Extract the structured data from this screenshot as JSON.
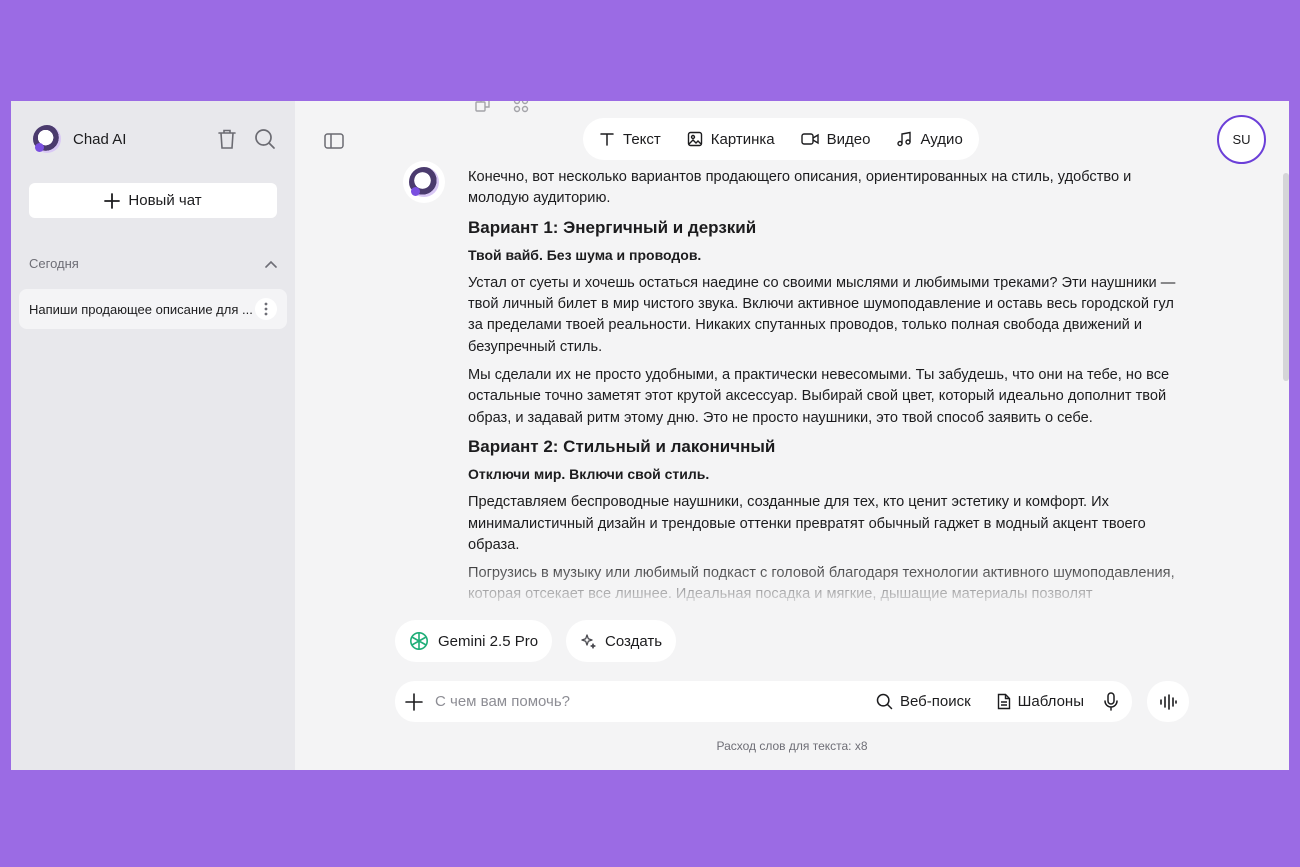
{
  "sidebar": {
    "brand": "Chad AI",
    "new_chat_label": "Новый чат",
    "section_title": "Сегодня",
    "history": [
      {
        "title": "Напиши продающее описание для ..."
      }
    ]
  },
  "modes": [
    {
      "label": "Текст",
      "icon": "text-icon"
    },
    {
      "label": "Картинка",
      "icon": "image-icon"
    },
    {
      "label": "Видео",
      "icon": "video-icon"
    },
    {
      "label": "Аудио",
      "icon": "music-icon"
    }
  ],
  "user": {
    "initials": "SU"
  },
  "message": {
    "intro": "Конечно, вот несколько вариантов продающего описания, ориентированных на стиль, удобство и молодую аудиторию.",
    "variant1": {
      "heading": "Вариант 1: Энергичный и дерзкий",
      "tagline": "Твой вайб. Без шума и проводов.",
      "p1": "Устал от суеты и хочешь остаться наедине со своими мыслями и любимыми треками? Эти наушники — твой личный билет в мир чистого звука. Включи активное шумоподавление и оставь весь городской гул за пределами твоей реальности. Никаких спутанных проводов, только полная свобода движений и безупречный стиль.",
      "p2": "Мы сделали их не просто удобными, а практически невесомыми. Ты забудешь, что они на тебе, но все остальные точно заметят этот крутой аксессуар. Выбирай свой цвет, который идеально дополнит твой образ, и задавай ритм этому дню. Это не просто наушники, это твой способ заявить о себе."
    },
    "variant2": {
      "heading": "Вариант 2: Стильный и лаконичный",
      "tagline": "Отключи мир. Включи свой стиль.",
      "p1": "Представляем беспроводные наушники, созданные для тех, кто ценит эстетику и комфорт. Их минималистичный дизайн и трендовые оттенки превратят обычный гаджет в модный акцент твоего образа.",
      "p2": "Погрузись в музыку или любимый подкаст с головой благодаря технологии активного шумоподавления, которая отсекает все лишнее. Идеальная посадка и мягкие, дышащие материалы позволят наслаждаться звуком часами без усталости. Будь в своём ритме каждый день."
    }
  },
  "chips": {
    "model": "Gemini 2.5 Pro",
    "create": "Создать"
  },
  "composer": {
    "placeholder": "С чем вам помочь?",
    "web_search": "Веб-поиск",
    "templates": "Шаблоны"
  },
  "usage_text": "Расход слов для текста: x8",
  "colors": {
    "background": "#9b6be4",
    "sidebar": "#e8e8ec",
    "main": "#f4f4f5",
    "accent": "#6b3fd8",
    "gemini": "#1fae78"
  }
}
